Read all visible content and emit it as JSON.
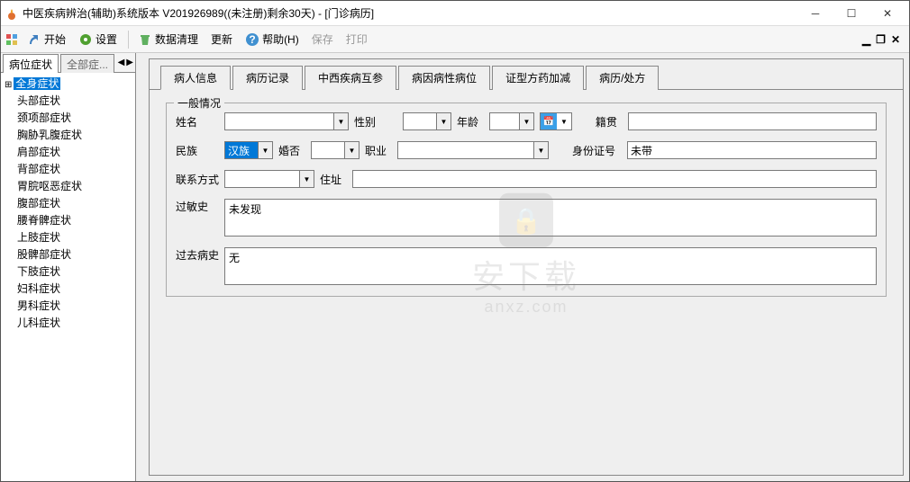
{
  "window": {
    "title": "中医疾病辨治(辅助)系统版本 V201926989((未注册)剩余30天) - [门诊病历]"
  },
  "toolbar": {
    "start": "开始",
    "settings": "设置",
    "dataClean": "数据清理",
    "update": "更新",
    "help": "帮助(H)",
    "save": "保存",
    "print": "打印"
  },
  "sidebar": {
    "tab1": "病位症状",
    "tab2": "全部症...",
    "items": [
      "全身症状",
      "头部症状",
      "颈项部症状",
      "胸胁乳腹症状",
      "肩部症状",
      "背部症状",
      "胃脘呕恶症状",
      "腹部症状",
      "腰脊髀症状",
      "上肢症状",
      "股髀部症状",
      "下肢症状",
      "妇科症状",
      "男科症状",
      "儿科症状"
    ]
  },
  "tabs": {
    "t1": "病人信息",
    "t2": "病历记录",
    "t3": "中西疾病互参",
    "t4": "病因病性病位",
    "t5": "证型方药加减",
    "t6": "病历/处方"
  },
  "form": {
    "groupTitle": "一般情况",
    "nameLabel": "姓名",
    "genderLabel": "性别",
    "ageLabel": "年龄",
    "nativeLabel": "籍贯",
    "ethnicLabel": "民族",
    "ethnicValue": "汉族",
    "marriageLabel": "婚否",
    "occupationLabel": "职业",
    "idLabel": "身份证号",
    "idValue": "未带",
    "contactLabel": "联系方式",
    "addressLabel": "住址",
    "allergyLabel": "过敏史",
    "allergyValue": "未发现",
    "historyLabel": "过去病史",
    "historyValue": "无"
  },
  "watermark": {
    "line1": "安下载",
    "line2": "anxz.com"
  }
}
